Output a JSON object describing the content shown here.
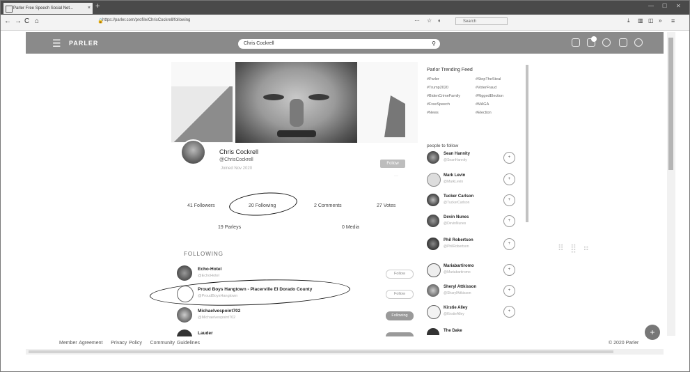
{
  "browser": {
    "tab_title": "Parler Free Speech Social Net...",
    "tab_close": "×",
    "new_tab": "+",
    "url": "https://parler.com/profile/ChrisCockrell/following",
    "search_placeholder": "Search"
  },
  "header": {
    "logo": "PARLER",
    "search_value": "Chris Cockrell"
  },
  "profile": {
    "name": "Chris Cockrell",
    "handle": "@ChrisCockrell",
    "joined": "Joined Nov 2020",
    "follow_label": "Follow",
    "stats": {
      "followers": "41 Followers",
      "following": "20 Following",
      "comments": "2 Comments",
      "votes": "27 Votes",
      "parleys": "19 Parleys",
      "media": "0 Media"
    },
    "section_title": "FOLLOWING"
  },
  "following": [
    {
      "name": "Echo-Hotel",
      "handle": "@EchoHotel",
      "button": "Follow"
    },
    {
      "name": "Proud Boys Hangtown - Placerville El Dorado County",
      "handle": "@ProudBoysHangtown",
      "button": "Follow"
    },
    {
      "name": "Michaelvespoint702",
      "handle": "@Michaelvespoint702",
      "button": "Following"
    },
    {
      "name": "Lauder",
      "handle": "",
      "button": ""
    }
  ],
  "trending": {
    "title": "Parlor Trending Feed",
    "tags": [
      "#Parler",
      "#StopTheSteal",
      "#Trump2020",
      "#VoterFraud",
      "#BidenCrimeFamily",
      "#RiggedElection",
      "#FreeSpeech",
      "#MAGA",
      "#News",
      "#Election"
    ]
  },
  "people": {
    "title": "people to follow",
    "items": [
      {
        "name": "Sean Hannity",
        "handle": "@SeanHannity",
        "add": "+"
      },
      {
        "name": "Mark Levin",
        "handle": "@MarkLevin",
        "add": "+"
      },
      {
        "name": "Tucker Carlson",
        "handle": "@TuckerCarlson",
        "add": "+"
      },
      {
        "name": "Devin Nunes",
        "handle": "@DevinNunes",
        "add": "+"
      },
      {
        "name": "Phil Robertson",
        "handle": "@PhilRobertson",
        "add": "+"
      },
      {
        "name": "Mariabartiromo",
        "handle": "@Mariabartiromo",
        "add": "+"
      },
      {
        "name": "Sheryl Attkisson",
        "handle": "@SharylAttkisson",
        "add": "+"
      },
      {
        "name": "Kirstie Alley",
        "handle": "@KirstieAlley",
        "add": "+"
      },
      {
        "name": "The Dake",
        "handle": "",
        "add": ""
      }
    ]
  },
  "footer": {
    "links": [
      "Member Agreement",
      "Privacy Policy",
      "Community Guidelines"
    ],
    "copyright": "© 2020 Parler",
    "fab": "+"
  }
}
